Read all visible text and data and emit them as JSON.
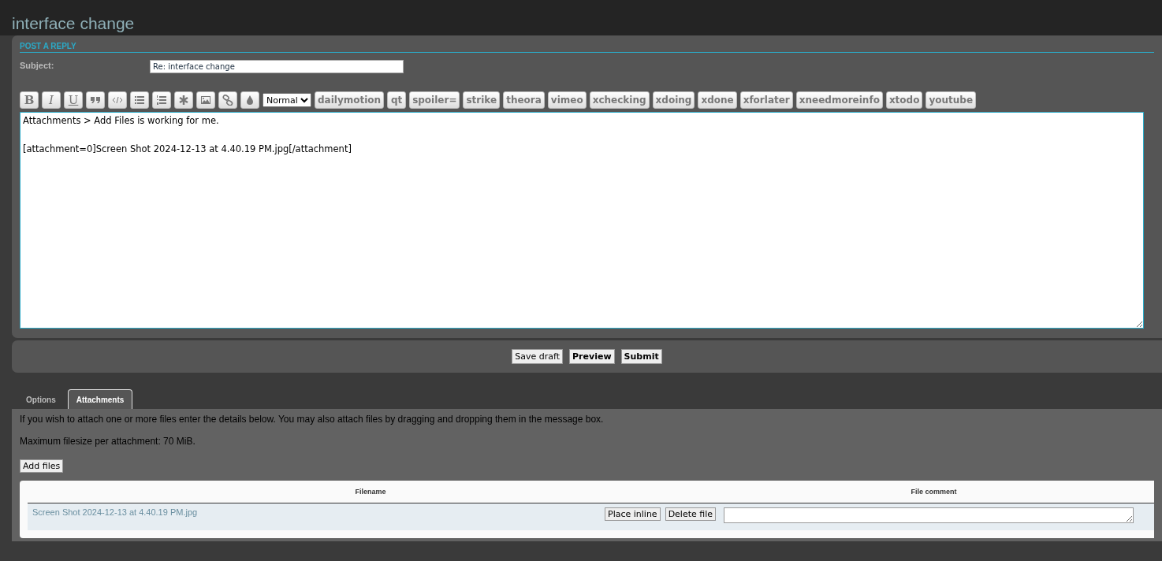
{
  "page_title": "interface change",
  "section_title": "POST A REPLY",
  "subject": {
    "label": "Subject:",
    "value": "Re: interface change"
  },
  "format_buttons": [
    "B",
    "I",
    "U"
  ],
  "font_size_select": "Normal",
  "bbcode_buttons": [
    "dailymotion",
    "qt",
    "spoiler=",
    "strike",
    "theora",
    "vimeo",
    "xchecking",
    "xdoing",
    "xdone",
    "xforlater",
    "xneedmoreinfo",
    "xtodo",
    "youtube"
  ],
  "message": "Attachments > Add Files is working for me.\n\n[attachment=0]Screen Shot 2024-12-13 at 4.40.19 PM.jpg[/attachment]",
  "actions": [
    {
      "label": "Save draft",
      "primary": false
    },
    {
      "label": "Preview",
      "primary": true
    },
    {
      "label": "Submit",
      "primary": true
    }
  ],
  "tabs": [
    {
      "label": "Options",
      "selected": false
    },
    {
      "label": "Attachments",
      "selected": true
    }
  ],
  "attach_info": "If you wish to attach one or more files enter the details below. You may also attach files by dragging and dropping them in the message box.",
  "max_size": "Maximum filesize per attachment: 70 MiB.",
  "add_files": "Add files",
  "table": {
    "columns": [
      "Filename",
      "File comment"
    ],
    "rows": [
      {
        "filename": "Screen Shot 2024-12-13 at 4.40.19 PM.jpg",
        "buttons": [
          "Place inline",
          "Delete file"
        ]
      }
    ]
  }
}
